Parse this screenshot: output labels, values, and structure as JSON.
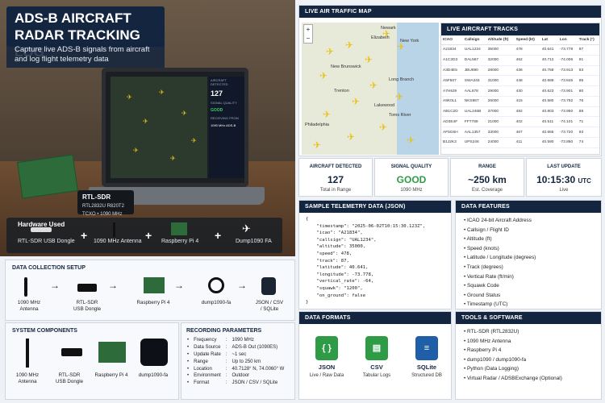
{
  "hero": {
    "title_line1": "ADS-B AIRCRAFT",
    "title_line2": "RADAR TRACKING LOG",
    "subtitle": "Capture live ADS-B signals from aircraft and log flight telemetry data",
    "sdr_label": "RTL-SDR",
    "sdr_sub1": "RTL2832U R820T2",
    "sdr_sub2": "TCXO • 1090 MHz",
    "screen_label1": "AIRCRAFT DETECTED",
    "screen_value": "127",
    "screen_label2": "SIGNAL QUALITY",
    "screen_good": "GOOD",
    "screen_label3": "RECEIVING FROM",
    "screen_freq": "1090 MHz ADS-B"
  },
  "hardware": {
    "title": "Hardware Used",
    "items": [
      "RTL-SDR USB Dongle",
      "1090 MHz Antenna",
      "Raspberry Pi 4",
      "Dump1090 FA"
    ]
  },
  "map": {
    "title": "LIVE AIR TRAFFIC MAP",
    "labels": [
      "Newark",
      "Elizabeth",
      "New York",
      "New Brunswick",
      "Long Branch",
      "Trenton",
      "Lakewood",
      "Toms River",
      "Philadelphia"
    ]
  },
  "tracks": {
    "title": "LIVE AIRCRAFT TRACKS",
    "columns": [
      "ICAO",
      "Callsign",
      "Altitude (ft)",
      "Speed (kt)",
      "Lat",
      "Lon",
      "Track (°)"
    ],
    "rows": [
      [
        "A21834",
        "UAL1234",
        "35000",
        "478",
        "40.641",
        "-73.778",
        "87"
      ],
      [
        "A1C2D3",
        "DAL567",
        "32000",
        "462",
        "40.712",
        "-74.006",
        "91"
      ],
      [
        "A3D4E5",
        "JBU890",
        "28000",
        "436",
        "40.758",
        "-73.913",
        "83"
      ],
      [
        "A5F607",
        "SWA345",
        "31000",
        "448",
        "40.689",
        "-73.845",
        "95"
      ],
      [
        "A7H8J9",
        "AAL678",
        "29000",
        "430",
        "40.623",
        "-73.901",
        "80"
      ],
      [
        "A9K0L1",
        "NKS987",
        "26000",
        "415",
        "40.580",
        "-73.792",
        "76"
      ],
      [
        "AB1C2D",
        "UAL246B",
        "37000",
        "482",
        "40.803",
        "-73.950",
        "88"
      ],
      [
        "AD3E4F",
        "FFT789",
        "21000",
        "402",
        "40.511",
        "-74.101",
        "71"
      ],
      [
        "AF5G6H",
        "AAL1357",
        "33000",
        "467",
        "40.665",
        "-73.720",
        "93"
      ],
      [
        "B1J2K3",
        "UPS246",
        "24000",
        "411",
        "40.590",
        "-73.860",
        "74"
      ]
    ]
  },
  "stats": [
    {
      "head": "AIRCRAFT DETECTED",
      "value": "127",
      "sub": "Total in Range"
    },
    {
      "head": "SIGNAL QUALITY",
      "value": "GOOD",
      "sub": "1090 MHz"
    },
    {
      "head": "RANGE",
      "value": "~250 km",
      "sub": "Est. Coverage"
    },
    {
      "head": "LAST UPDATE",
      "value": "10:15:30",
      "unit": "UTC",
      "sub": "Live"
    }
  ],
  "telemetry": {
    "title": "SAMPLE TELEMETRY DATA (JSON)",
    "code": "{\n    \"timestamp\": \"2025-06-02T10:15:30.123Z\",\n    \"icao\": \"A21834\",\n    \"callsign\": \"UAL1234\",\n    \"altitude\": 35000,\n    \"speed\": 478,\n    \"track\": 87,\n    \"latitude\": 40.641,\n    \"longitude\": -73.778,\n    \"vertical_rate\": -64,\n    \"squawk\": \"1200\",\n    \"on_ground\": false\n}"
  },
  "features": {
    "title": "DATA FEATURES",
    "items": [
      "ICAO 24-bit Aircraft Address",
      "Callsign / Flight ID",
      "Altitude (ft)",
      "Speed (knots)",
      "Latitude / Longitude (degrees)",
      "Track (degrees)",
      "Vertical Rate (ft/min)",
      "Squawk Code",
      "Ground Status",
      "Timestamp (UTC)"
    ]
  },
  "collection": {
    "title": "DATA COLLECTION SETUP",
    "steps": [
      "1090 MHz\nAntenna",
      "RTL-SDR\nUSB Dongle",
      "Raspberry Pi 4",
      "dump1090-fa",
      "JSON / CSV\n/ SQLite"
    ]
  },
  "components": {
    "title": "SYSTEM COMPONENTS",
    "items": [
      "1090 MHz\nAntenna",
      "RTL-SDR\nUSB Dongle",
      "Raspberry Pi 4",
      "dump1090-fa"
    ]
  },
  "params": {
    "title": "RECORDING PARAMETERS",
    "rows": [
      [
        "Frequency",
        "1090 MHz"
      ],
      [
        "Data Source",
        "ADS-B Out (1090ES)"
      ],
      [
        "Update Rate",
        "~1 sec"
      ],
      [
        "Range",
        "Up to 250 km"
      ],
      [
        "Location",
        "40.7128° N, 74.0060° W"
      ],
      [
        "Environment",
        "Outdoor"
      ],
      [
        "Format",
        "JSON / CSV / SQLite"
      ]
    ]
  },
  "formats": {
    "title": "DATA FORMATS",
    "items": [
      {
        "name": "JSON",
        "sub": "Live / Raw Data",
        "color": "#2e9b46"
      },
      {
        "name": "CSV",
        "sub": "Tabular Logs",
        "color": "#2e9b46"
      },
      {
        "name": "SQLite",
        "sub": "Structured DB",
        "color": "#1f5fa8"
      }
    ]
  },
  "tools": {
    "title": "TOOLS & SOFTWARE",
    "items": [
      "RTL-SDR (RTL2832U)",
      "1090 MHz Antenna",
      "Raspberry Pi 4",
      "dump1090 / dump1090-fa",
      "Python (Data Logging)",
      "Virtual Radar / ADSBExchange (Optional)"
    ]
  },
  "colors": {
    "navy": "#13253f",
    "good": "#2e9b46",
    "plane": "#e8c21a"
  }
}
